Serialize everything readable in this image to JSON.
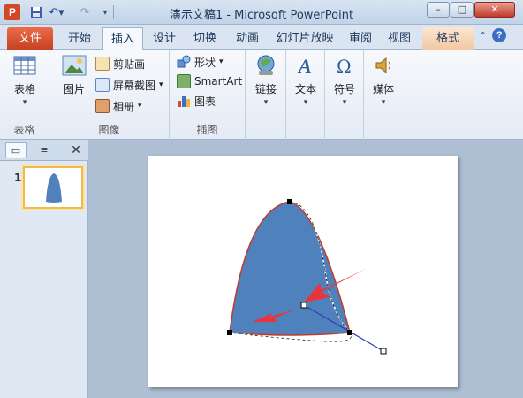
{
  "app": {
    "title": "演示文稿1 - Microsoft PowerPoint",
    "logo_letter": "P"
  },
  "tabs": [
    {
      "label": "文件"
    },
    {
      "label": "开始"
    },
    {
      "label": "插入"
    },
    {
      "label": "设计"
    },
    {
      "label": "切换"
    },
    {
      "label": "动画"
    },
    {
      "label": "幻灯片放映"
    },
    {
      "label": "审阅"
    },
    {
      "label": "视图"
    },
    {
      "label": "格式"
    }
  ],
  "ribbon": {
    "tables": {
      "label": "表格",
      "group": "表格"
    },
    "images": {
      "picture": "图片",
      "clipart": "剪贴画",
      "screenshot": "屏幕截图",
      "album": "相册",
      "group": "图像"
    },
    "illustrations": {
      "shapes": "形状",
      "smartart": "SmartArt",
      "chart": "图表",
      "group": "插图"
    },
    "links": {
      "label": "链接"
    },
    "text": {
      "label": "文本"
    },
    "symbols": {
      "label": "符号"
    },
    "media": {
      "label": "媒体"
    }
  },
  "slides_panel": {
    "slide_number": "1"
  },
  "colors": {
    "shape_fill": "#4f81bd",
    "shape_outline": "#c0392b",
    "arrow": "#e8343a",
    "handle_line": "#2b3fb3"
  },
  "icons": {
    "save": "save-icon",
    "undo": "undo-icon",
    "redo": "redo-icon",
    "help": "help-icon",
    "close": "close-icon"
  }
}
